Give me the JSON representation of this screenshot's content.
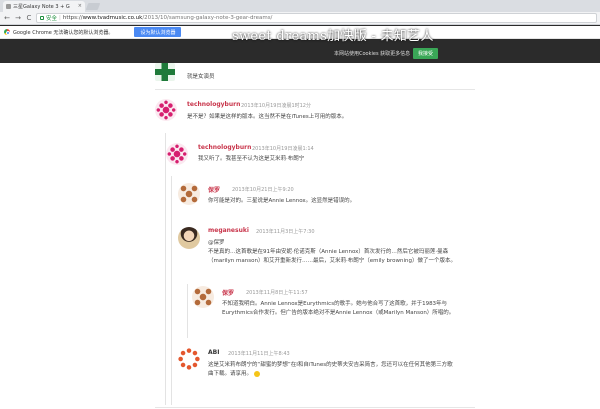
{
  "browser": {
    "tab_title": "三星Galaxy Note 3 + G",
    "tab_close": "×",
    "nav_back": "←",
    "nav_forward": "→",
    "nav_reload": "C",
    "secure_label": "安全",
    "url_separator": "|",
    "url_scheme": "https://",
    "url_host": "www.tvadmusic.co.uk",
    "url_path": "/2013/10/samsung-galaxy-note-3-gear-dreams/"
  },
  "infobar": {
    "message": "Google Chrome 无法确认您的默认浏览器。",
    "set_default_label": "设为默认浏览器"
  },
  "site": {
    "title": "sweet dreams加快版 - 未知艺人",
    "cookie_notice": "本网站使用Cookies 获取更多信息",
    "cookie_accept_label": "我接受"
  },
  "comments": [
    {
      "id": "c0",
      "author": "",
      "meta": "",
      "body": "就是女演员",
      "avatar": "green-icon"
    },
    {
      "id": "c1",
      "author": "technologyburn",
      "meta": "2013年10月19日凌晨1时12分",
      "body": "是不是？如果是这样的版本。这当然不是在iTunes上可用的版本。",
      "avatar": "pink-identicon"
    },
    {
      "id": "c2",
      "author": "technologyburn",
      "meta": "2013年10月19日凌晨1:14",
      "body": "我又听了。我甚至不认为这是艾米莉·布朗宁",
      "avatar": "pink-identicon"
    },
    {
      "id": "c3",
      "author": "保罗",
      "meta": "2013年10月21日上午9:20",
      "body": "你可能是对的。三星说是Annie Lennox。这显然是错误的。",
      "avatar": "brown-identicon"
    },
    {
      "id": "c4",
      "author": "meganesuki",
      "meta": "2013年11月3日上午7:30",
      "body_lines": [
        "@保罗",
        "不是真的…这首歌是在91年由安妮·伦诺克斯（Annie Lennox）首次发行的…然后它被玛丽莲·曼森",
        "（marilyn manson）和艾开重新发行……最后，艾米莉·布朗宁（emily browning）做了一个版本。"
      ],
      "avatar": "photo-avatar"
    },
    {
      "id": "c5",
      "author": "保罗",
      "meta": "2013年11月8日上午11:57",
      "body_lines": [
        "不知道我明白。Annie Lennox是Eurythmics的歌手。她与他合写了这首歌，并于1983年与",
        "Eurythmics合作发行。但广告的版本绝对不是Annie Lennox（或Marilyn Manson）所唱的。"
      ],
      "avatar": "brown-identicon"
    },
    {
      "id": "c6",
      "author": "ABI",
      "meta": "2013年11月11日上午8:43",
      "body_lines": [
        "这是艾米莉布朗宁的“甜蜜的梦想”在I和自iTunes的史蒂夫安吉采简言，您还可以在任何其他第三方歌",
        "曲下载。请享用。"
      ],
      "avatar": "orange-identicon"
    }
  ]
}
